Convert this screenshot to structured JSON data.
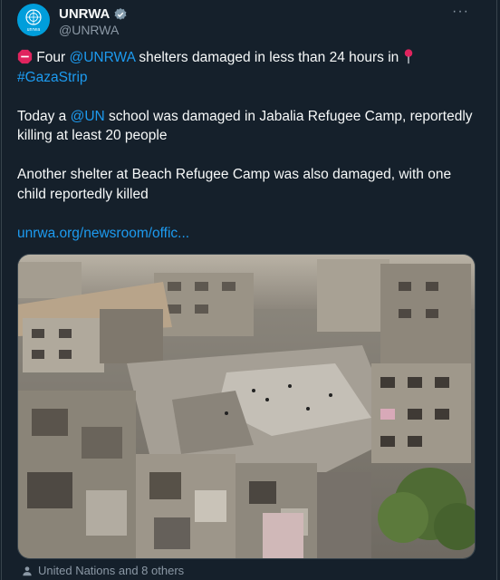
{
  "account": {
    "name": "UNRWA",
    "handle": "@UNRWA",
    "logo_text": "unrwa",
    "brand_color": "#009edb",
    "verified_icon": "verified-badge-icon"
  },
  "more_label": "···",
  "tweet": {
    "line1_pre": " Four ",
    "line1_mention": "@UNRWA",
    "line1_post": " shelters damaged in less than 24 hours in ",
    "line1_hashtag": "#GazaStrip",
    "line2_pre": "Today a ",
    "line2_mention": "@UN",
    "line2_post": " school was damaged in Jabalia Refugee Camp, reportedly killing at least 20 people",
    "line3": "Another shelter at Beach Refugee Camp was also damaged, with one child reportedly killed",
    "url": "unrwa.org/newsroom/offic..."
  },
  "footer": {
    "tagged": "United Nations and 8 others",
    "icon": "person-icon"
  },
  "colors": {
    "background": "#15202b",
    "link": "#1d9bf0",
    "muted": "#8b98a5",
    "stop_sign": "#e0245e",
    "pin": "#e0245e"
  }
}
